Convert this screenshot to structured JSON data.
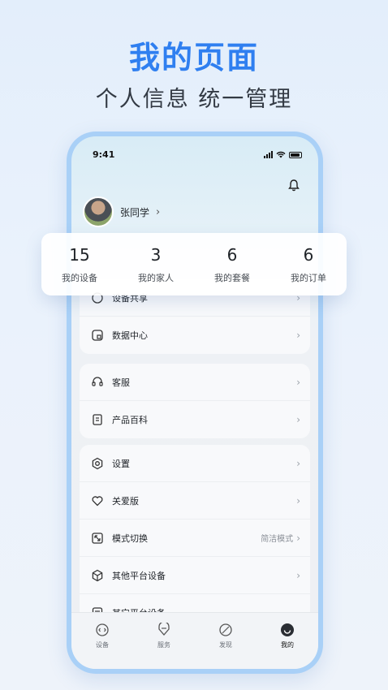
{
  "promo": {
    "headline": "我的页面",
    "subline": "个人信息  统一管理"
  },
  "status": {
    "time": "9:41"
  },
  "profile": {
    "name": "张同学",
    "chevron": "›"
  },
  "stats": [
    {
      "value": "15",
      "label": "我的设备"
    },
    {
      "value": "3",
      "label": "我的家人"
    },
    {
      "value": "6",
      "label": "我的套餐"
    },
    {
      "value": "6",
      "label": "我的订单"
    }
  ],
  "group1": [
    {
      "label": "设备共享",
      "icon": "share-icon"
    },
    {
      "label": "数据中心",
      "icon": "data-center-icon"
    }
  ],
  "group2": [
    {
      "label": "客服",
      "icon": "headset-icon"
    },
    {
      "label": "产品百科",
      "icon": "book-icon"
    }
  ],
  "group3": [
    {
      "label": "设置",
      "icon": "gear-icon"
    },
    {
      "label": "关爱版",
      "icon": "heart-icon"
    },
    {
      "label": "模式切换",
      "icon": "mode-switch-icon",
      "value": "简洁模式"
    },
    {
      "label": "其他平台设备",
      "icon": "cube-icon"
    },
    {
      "label": "其它平台设备",
      "icon": "list-icon"
    }
  ],
  "tabs": [
    {
      "label": "设备",
      "icon": "device-icon"
    },
    {
      "label": "服务",
      "icon": "service-icon"
    },
    {
      "label": "发现",
      "icon": "discover-icon"
    },
    {
      "label": "我的",
      "icon": "profile-icon",
      "active": true
    }
  ]
}
